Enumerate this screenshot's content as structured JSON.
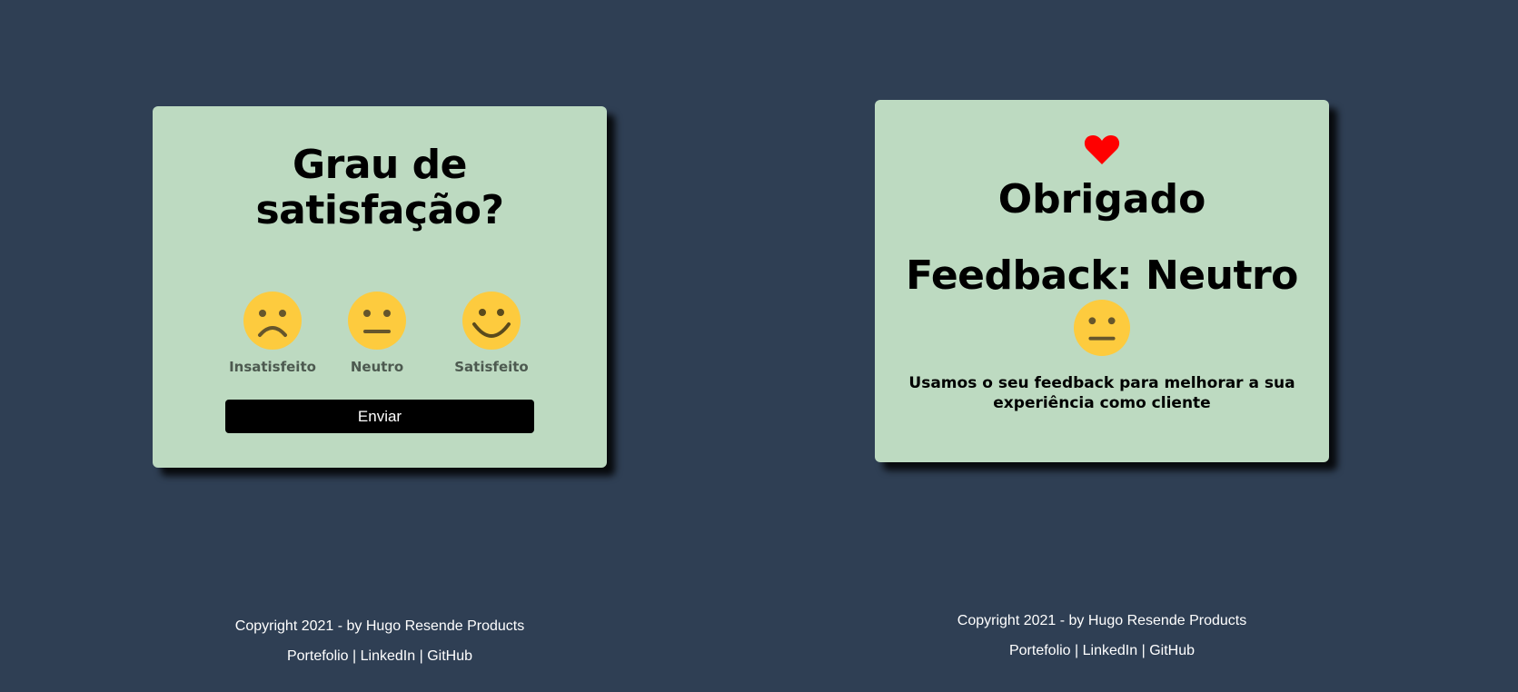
{
  "rating_card": {
    "title_line1": "Grau de",
    "title_line2": "satisfação?",
    "options": [
      {
        "label": "Insatisfeito",
        "icon": "sad-face-icon"
      },
      {
        "label": "Neutro",
        "icon": "neutral-face-icon"
      },
      {
        "label": "Satisfeito",
        "icon": "happy-face-icon"
      }
    ],
    "submit_label": "Enviar"
  },
  "thanks_card": {
    "icon": "heart-icon",
    "title": "Obrigado",
    "feedback_text": "Feedback: Neutro",
    "feedback_icon": "neutral-face-icon",
    "message": "Usamos o seu feedback para melhorar a sua experiência como cliente"
  },
  "footer": {
    "copyright": "Copyright 2021 - by Hugo Resende Products",
    "links": [
      "Portefolio",
      "LinkedIn",
      "GitHub"
    ],
    "separator": "|"
  },
  "colors": {
    "background": "#2f3f54",
    "card": "#bddac1",
    "button": "#000000",
    "emoji": "#fdcb3e",
    "heart": "#ff0000"
  }
}
